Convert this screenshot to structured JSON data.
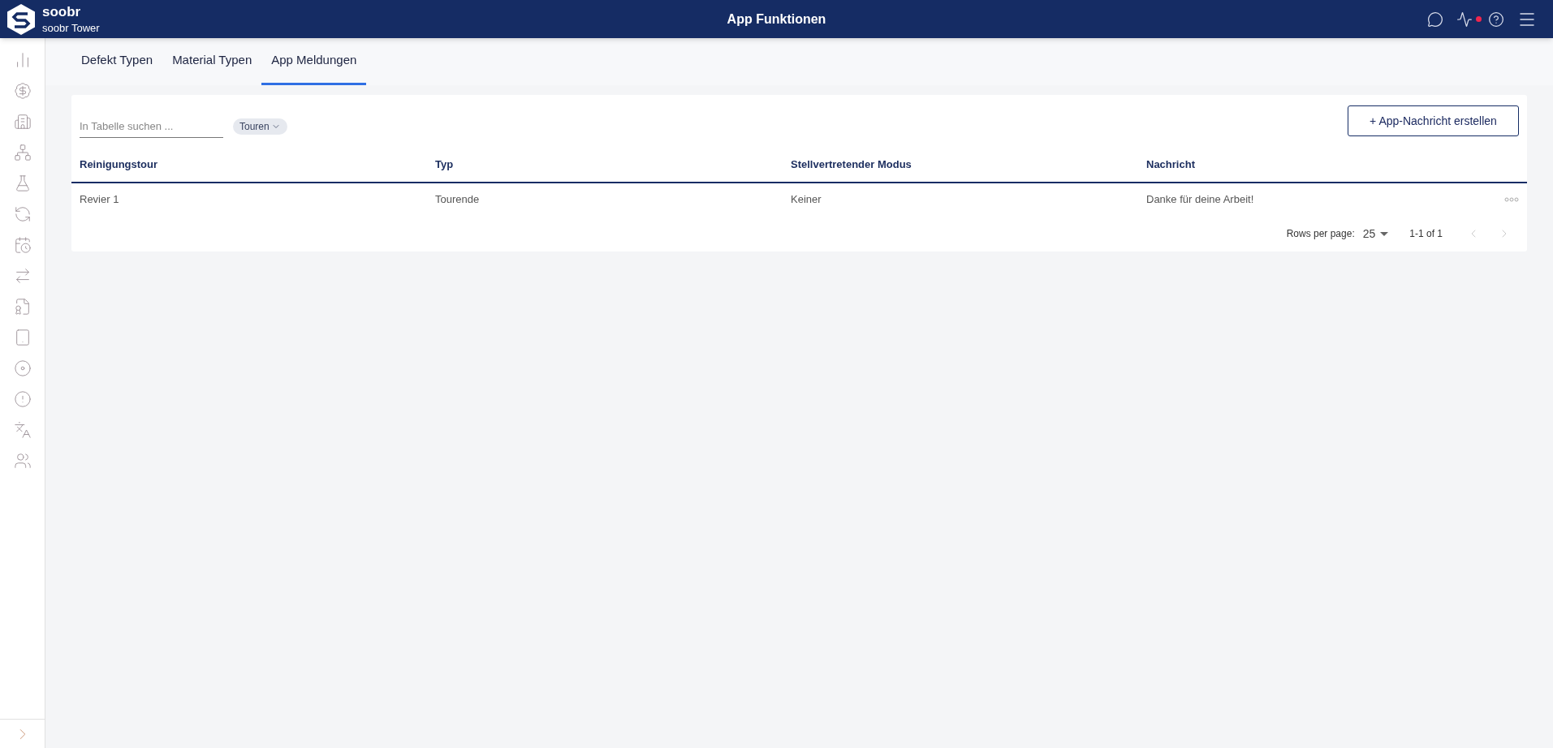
{
  "header": {
    "brand": "soobr",
    "subtitle": "soobr Tower",
    "title": "App Funktionen",
    "notification": true
  },
  "tabs": [
    {
      "label": "Defekt Typen",
      "selected": false
    },
    {
      "label": "Material Typen",
      "selected": false
    },
    {
      "label": "App Meldungen",
      "selected": true
    }
  ],
  "search": {
    "placeholder": "In Tabelle suchen ..."
  },
  "filter_chip": "Touren",
  "create_button": "+ App-Nachricht erstellen",
  "table": {
    "columns": [
      "Reinigungstour",
      "Typ",
      "Stellvertretender Modus",
      "Nachricht"
    ],
    "rows": [
      {
        "cells": [
          "Revier 1",
          "Tourende",
          "Keiner",
          "Danke für deine Arbeit!"
        ]
      }
    ]
  },
  "pagination": {
    "rows_label": "Rows per page:",
    "rows_value": "25",
    "range": "1-1 of 1"
  }
}
